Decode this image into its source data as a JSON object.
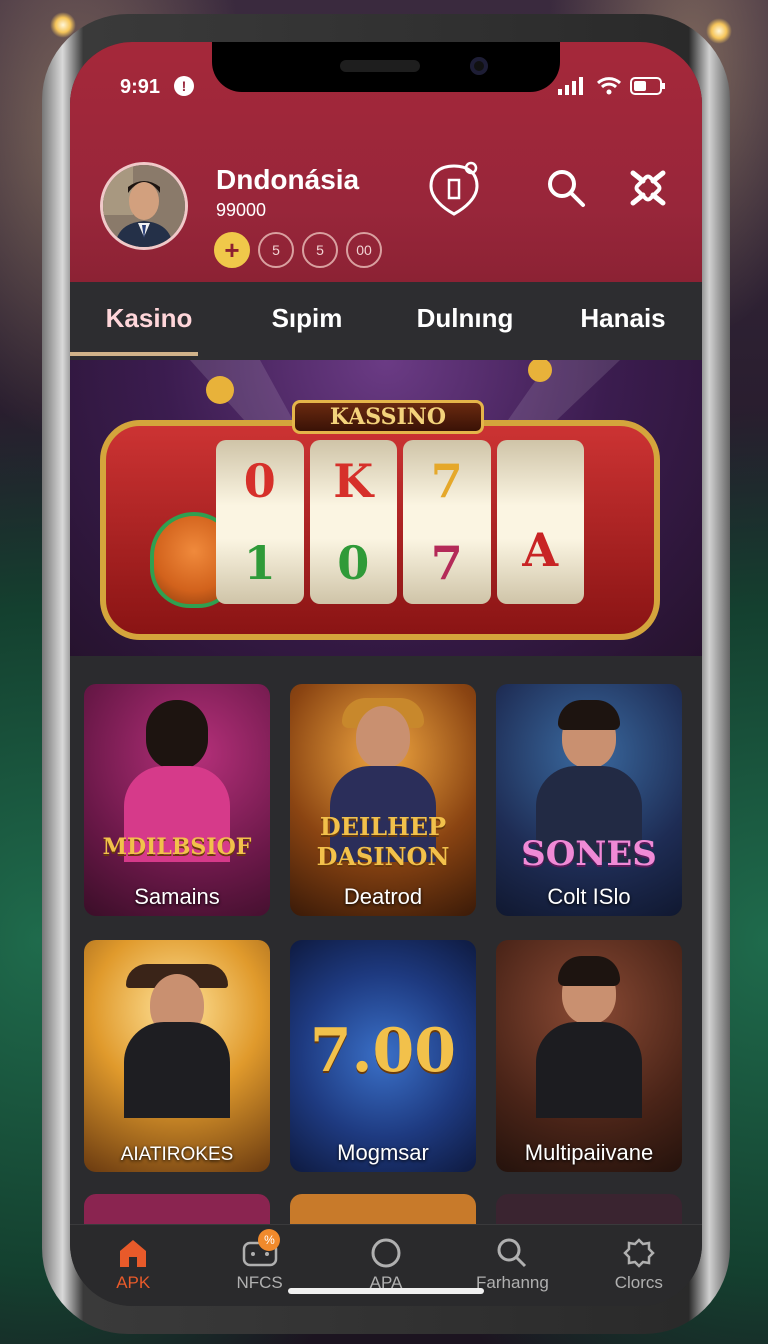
{
  "status_bar": {
    "time": "9:91",
    "info_glyph": "!"
  },
  "profile": {
    "name": "Dndonásia",
    "balance": "99000",
    "chips": [
      "+",
      "5",
      "5",
      "00"
    ]
  },
  "tabs": [
    "Kasino",
    "Sıpim",
    "Dulnıng",
    "Hanais"
  ],
  "active_tab": 0,
  "banner": {
    "title": "KASSINO",
    "reels": [
      [
        "0",
        "1"
      ],
      [
        "K",
        "0"
      ],
      [
        "7",
        "7"
      ],
      [
        "",
        "A"
      ]
    ]
  },
  "games": [
    {
      "title": "MDILBSIOF",
      "label": "Samains"
    },
    {
      "title": "DEILHEP DASINON",
      "label": "Deatrod"
    },
    {
      "title": "SONES",
      "label": "Colt ISlo"
    },
    {
      "title": "AIATIROKES",
      "label": "AIATIROKES"
    },
    {
      "title": "7.00",
      "label": "Mogmsar"
    },
    {
      "title": "",
      "label": "Multipaiivane"
    }
  ],
  "bottom_nav": [
    {
      "label": "APK",
      "icon": "home-icon"
    },
    {
      "label": "NFCS",
      "icon": "gamepad-icon",
      "badge": "%"
    },
    {
      "label": "APA",
      "icon": "circle-icon"
    },
    {
      "label": "Farhanng",
      "icon": "search-icon"
    },
    {
      "label": "Clorcs",
      "icon": "settings-icon"
    }
  ],
  "colors": {
    "header": "#98263a",
    "accent": "#e85a2a",
    "gold": "#f0c84a"
  }
}
